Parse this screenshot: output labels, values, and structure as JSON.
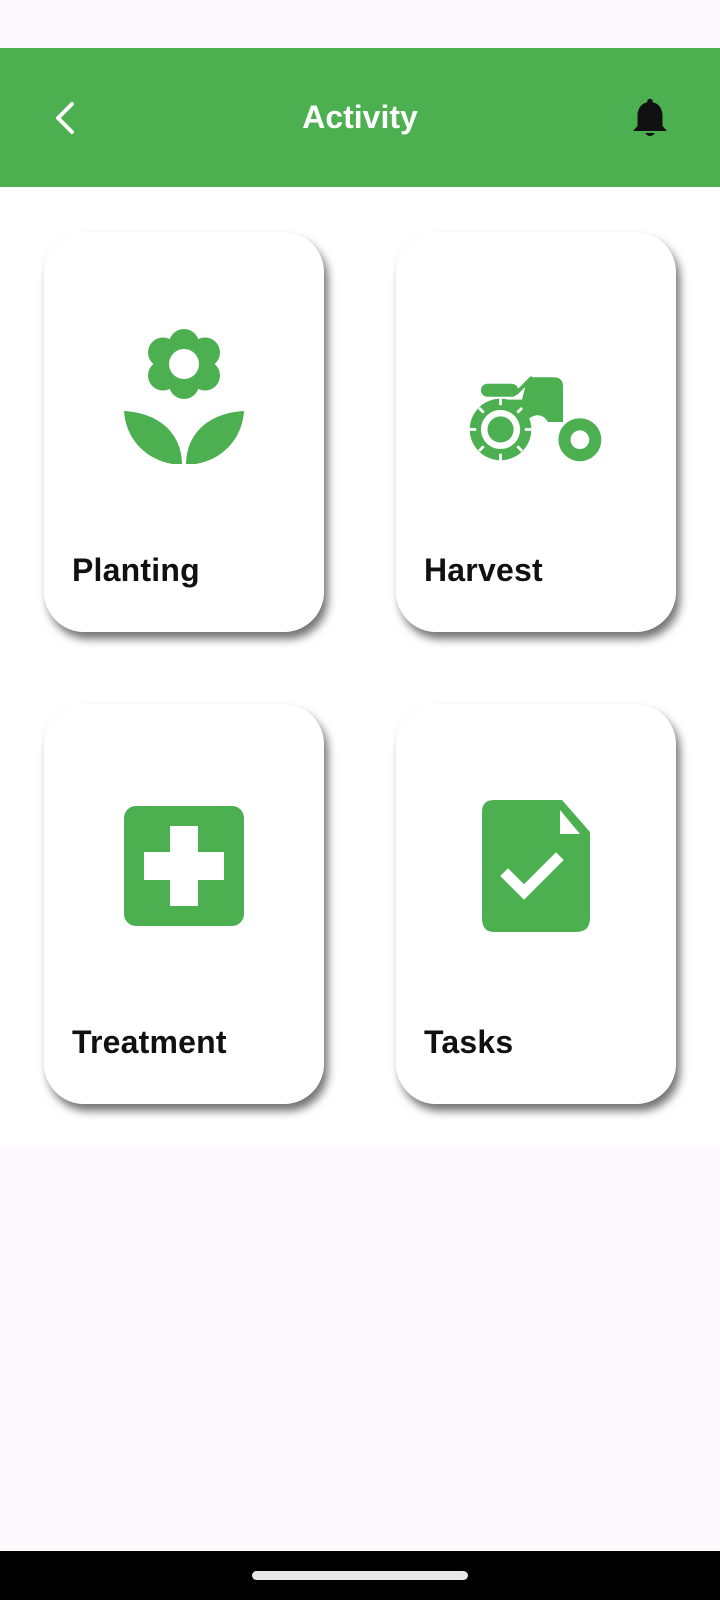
{
  "header": {
    "title": "Activity",
    "back_icon": "chevron-left-icon",
    "notification_icon": "bell-icon"
  },
  "colors": {
    "accent": "#4caf50",
    "background": "#ffffff",
    "label": "#111111"
  },
  "cards": [
    {
      "label": "Planting",
      "icon": "flower-icon"
    },
    {
      "label": "Harvest",
      "icon": "tractor-icon"
    },
    {
      "label": "Treatment",
      "icon": "medical-cross-icon"
    },
    {
      "label": "Tasks",
      "icon": "task-document-check-icon"
    }
  ]
}
